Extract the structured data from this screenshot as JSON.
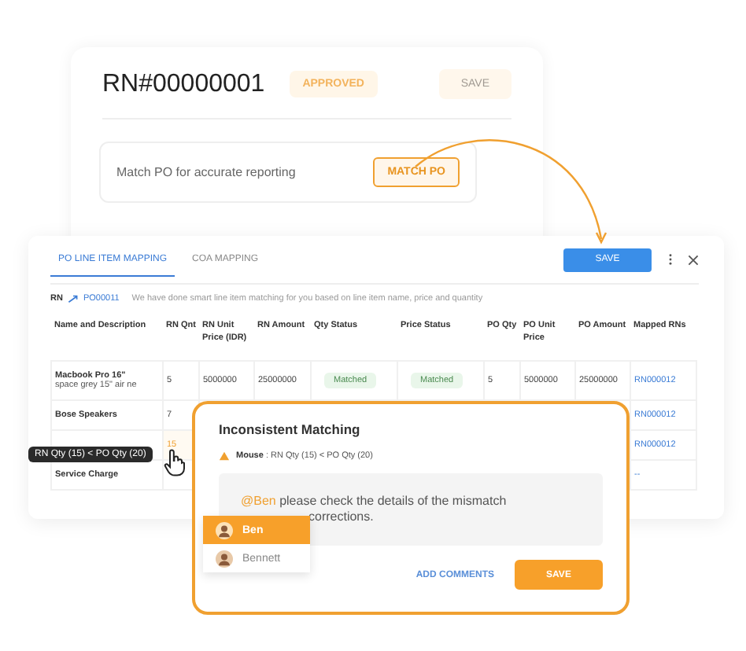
{
  "receipt_card": {
    "title": "RN#00000001",
    "status": "APPROVED",
    "save_button": "SAVE",
    "match_prompt": "Match PO for accurate reporting",
    "match_button": "MATCH PO"
  },
  "mapping_panel": {
    "tabs": [
      {
        "label": "PO LINE ITEM MAPPING",
        "selected": true
      },
      {
        "label": "COA MAPPING",
        "selected": false
      }
    ],
    "save_button": "SAVE",
    "link_from": "RN",
    "link_to": "PO00011",
    "info": "We have done smart line item matching for you based on line item name, price and quantity",
    "table": {
      "columns": [
        "Name and Description",
        "RN Qnt",
        "RN Unit Price (IDR)",
        "RN Amount",
        "Qty Status",
        "Price Status",
        "PO Qty",
        "PO Unit Price",
        "PO Amount",
        "Mapped RNs"
      ],
      "rows": [
        {
          "description": "space grey 15\" air ne",
          "flagged": false,
          "cells": [
            "Macbook Pro 16\"",
            "5",
            "5000000",
            "25000000",
            "Matched",
            "Matched",
            "5",
            "5000000",
            "25000000",
            "RN000012"
          ]
        },
        {
          "flagged": false,
          "cells": [
            "Bose Speakers",
            "7",
            null,
            null,
            null,
            null,
            null,
            null,
            null,
            "RN000012"
          ]
        },
        {
          "flagged": true,
          "cells": [
            null,
            "15",
            null,
            null,
            null,
            null,
            null,
            null,
            null,
            "RN000012"
          ]
        },
        {
          "flagged": false,
          "cells": [
            "Service Charge",
            null,
            null,
            null,
            null,
            null,
            null,
            null,
            null,
            "--"
          ]
        }
      ]
    }
  },
  "tooltip": "RN Qty (15) < PO Qty (20)",
  "popup": {
    "title": "Inconsistent Matching",
    "warning_item": "Mouse",
    "warning_text": ": RN Qty (15) < PO Qty (20)",
    "mention": "@Ben",
    "comment_line": "please check the details of the mismatch",
    "comment_end": "corrections.",
    "suggestions": [
      {
        "name": "Ben",
        "selected": true
      },
      {
        "name": "Bennett",
        "selected": false
      }
    ],
    "add_comments": "ADD COMMENTS",
    "save_button": "SAVE"
  }
}
